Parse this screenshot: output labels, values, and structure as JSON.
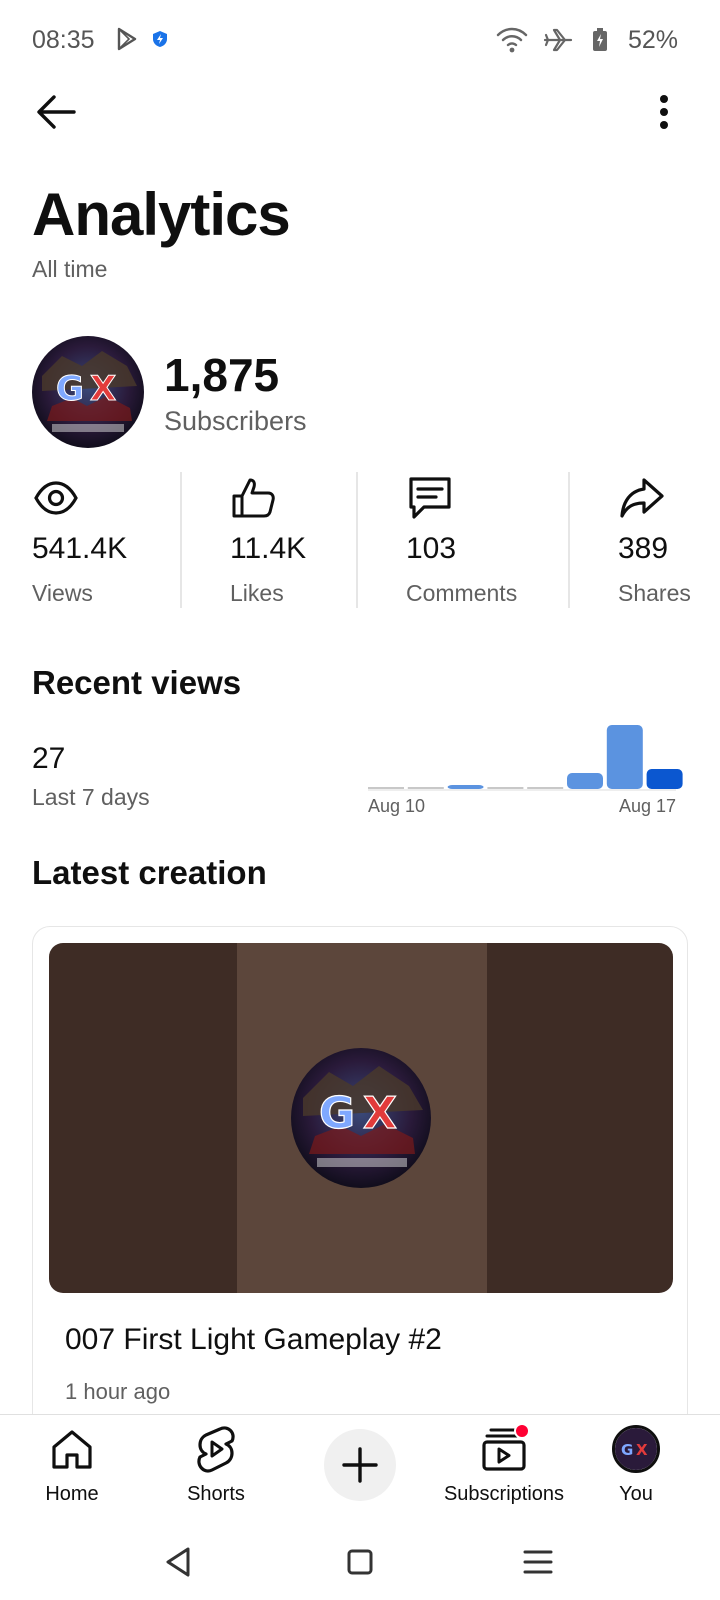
{
  "status_bar": {
    "time": "08:35",
    "battery": "52%",
    "icons": [
      "play-store-icon",
      "shield-icon",
      "wifi-icon",
      "airplane-icon",
      "battery-icon"
    ]
  },
  "header": {
    "title": "Analytics",
    "subtitle": "All time"
  },
  "channel": {
    "subscribers": "1,875",
    "subscribers_label": "Subscribers"
  },
  "stats": [
    {
      "icon": "eye-icon",
      "value": "541.4K",
      "label": "Views"
    },
    {
      "icon": "thumbs-up-icon",
      "value": "11.4K",
      "label": "Likes"
    },
    {
      "icon": "comment-icon",
      "value": "103",
      "label": "Comments"
    },
    {
      "icon": "share-icon",
      "value": "389",
      "label": "Shares"
    }
  ],
  "recent_views": {
    "title": "Recent views",
    "value": "27",
    "label": "Last 7 days"
  },
  "chart_data": {
    "type": "bar",
    "categories": [
      "d1",
      "d2",
      "d3",
      "d4",
      "d5",
      "d6",
      "d7",
      "d8"
    ],
    "values": [
      0,
      0,
      1,
      0,
      0,
      4,
      16,
      5
    ],
    "tick_labels": [
      "Aug 10",
      "Aug 17"
    ],
    "colors": [
      "#5b93e0",
      "#5b93e0",
      "#5b93e0",
      "#5b93e0",
      "#5b93e0",
      "#5b93e0",
      "#5b93e0",
      "#0b57d0"
    ],
    "ylim": [
      0,
      16
    ]
  },
  "latest": {
    "title": "Latest creation",
    "video_title": "007 First Light Gameplay #2",
    "video_time": "1 hour ago"
  },
  "bottom_nav": {
    "home": "Home",
    "shorts": "Shorts",
    "subscriptions": "Subscriptions",
    "you": "You"
  },
  "colors": {
    "accent_bar": "#5b93e0",
    "accent_bar_current": "#0b57d0",
    "notification": "#ff0033"
  }
}
